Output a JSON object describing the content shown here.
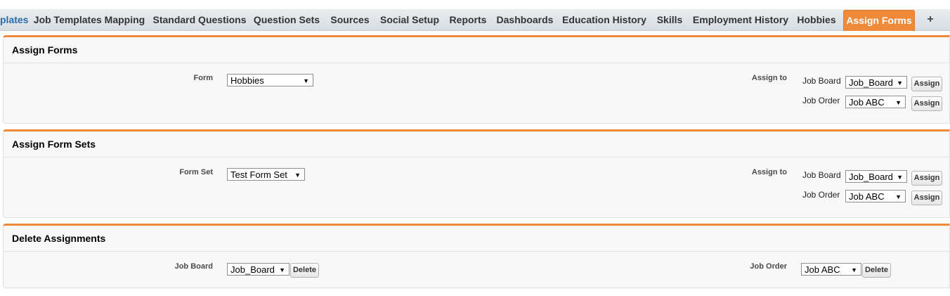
{
  "tabs": [
    {
      "label": "plates"
    },
    {
      "label": "Job Templates Mapping"
    },
    {
      "label": "Standard Questions"
    },
    {
      "label": "Question Sets"
    },
    {
      "label": "Sources"
    },
    {
      "label": "Social Setup"
    },
    {
      "label": "Reports"
    },
    {
      "label": "Dashboards"
    },
    {
      "label": "Education History"
    },
    {
      "label": "Skills"
    },
    {
      "label": "Employment History"
    },
    {
      "label": "Hobbies"
    },
    {
      "label": "Assign Forms"
    },
    {
      "label": "+"
    }
  ],
  "colors": {
    "accent": "#f08a3b",
    "link": "#2a6cac"
  },
  "assign_forms": {
    "title": "Assign Forms",
    "form_label": "Form",
    "form_value": "Hobbies",
    "assign_to_label": "Assign to",
    "job_board_label": "Job Board",
    "job_board_value": "Job_Board",
    "job_order_label": "Job Order",
    "job_order_value": "Job ABC",
    "assign_label": "Assign"
  },
  "assign_form_sets": {
    "title": "Assign Form Sets",
    "form_set_label": "Form Set",
    "form_set_value": "Test Form Set",
    "assign_to_label": "Assign to",
    "job_board_label": "Job Board",
    "job_board_value": "Job_Board",
    "job_order_label": "Job Order",
    "job_order_value": "Job ABC",
    "assign_label": "Assign"
  },
  "delete_assignments": {
    "title": "Delete Assignments",
    "job_board_label": "Job Board",
    "job_board_value": "Job_Board",
    "job_order_label": "Job Order",
    "job_order_value": "Job ABC",
    "delete_label": "Delete"
  }
}
